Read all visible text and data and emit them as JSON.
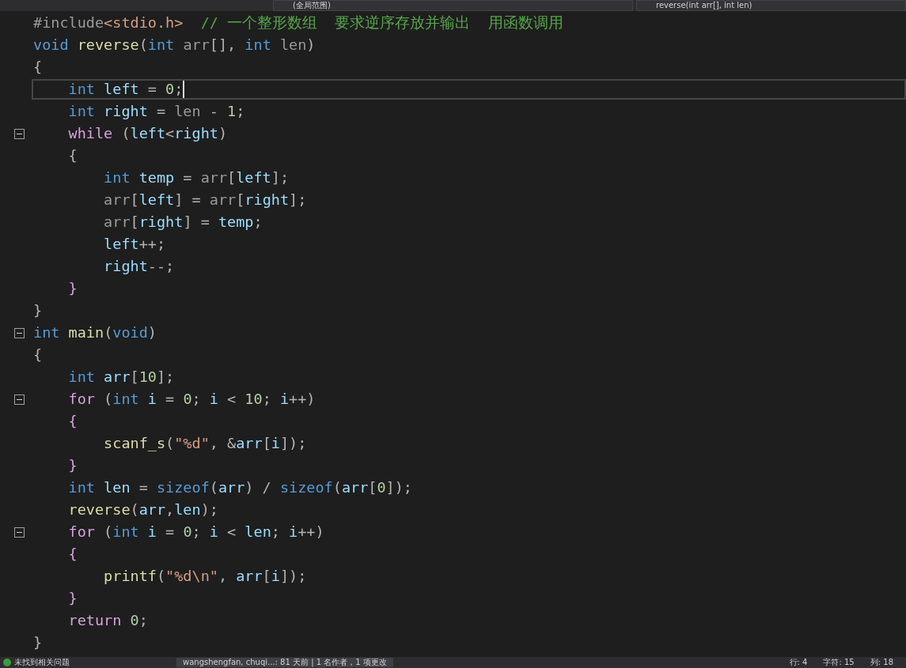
{
  "navigation_bar": {
    "scope": "(全局范围)",
    "member": "reverse(int arr[], int len)"
  },
  "lines": [
    {
      "fold": false,
      "current": false,
      "tokens": [
        {
          "text": "#include",
          "kind": "pp"
        },
        {
          "text": "<stdio.h>",
          "kind": "str"
        },
        {
          "text": "  // 一个整形数组  要求逆序存放并输出  用函数调用",
          "kind": "cmt"
        }
      ]
    },
    {
      "fold": false,
      "current": false,
      "tokens": [
        {
          "text": "void ",
          "kind": "kw"
        },
        {
          "text": "reverse",
          "kind": "fn"
        },
        {
          "text": "(",
          "kind": "p"
        },
        {
          "text": "int ",
          "kind": "kw"
        },
        {
          "text": "arr",
          "kind": "param"
        },
        {
          "text": "[], ",
          "kind": "p"
        },
        {
          "text": "int ",
          "kind": "kw"
        },
        {
          "text": "len",
          "kind": "param"
        },
        {
          "text": ")",
          "kind": "p"
        }
      ]
    },
    {
      "fold": false,
      "current": false,
      "tokens": [
        {
          "text": "{",
          "kind": "p"
        }
      ]
    },
    {
      "fold": false,
      "current": true,
      "tokens": [
        {
          "text": "    int ",
          "kind": "kw"
        },
        {
          "text": "left",
          "kind": "var"
        },
        {
          "text": " = ",
          "kind": "p"
        },
        {
          "text": "0",
          "kind": "num"
        },
        {
          "text": ";",
          "kind": "p"
        }
      ]
    },
    {
      "fold": false,
      "current": false,
      "tokens": [
        {
          "text": "    int ",
          "kind": "kw"
        },
        {
          "text": "right",
          "kind": "var"
        },
        {
          "text": " = ",
          "kind": "p"
        },
        {
          "text": "len",
          "kind": "param"
        },
        {
          "text": " - ",
          "kind": "p"
        },
        {
          "text": "1",
          "kind": "num"
        },
        {
          "text": ";",
          "kind": "p"
        }
      ]
    },
    {
      "fold": true,
      "current": false,
      "tokens": [
        {
          "text": "    while",
          "kind": "ctrl"
        },
        {
          "text": " (",
          "kind": "p"
        },
        {
          "text": "left",
          "kind": "var"
        },
        {
          "text": "<",
          "kind": "p"
        },
        {
          "text": "right",
          "kind": "var"
        },
        {
          "text": ")",
          "kind": "p"
        }
      ]
    },
    {
      "fold": false,
      "current": false,
      "tokens": [
        {
          "text": "    {",
          "kind": "p"
        }
      ]
    },
    {
      "fold": false,
      "current": false,
      "tokens": [
        {
          "text": "        int ",
          "kind": "kw"
        },
        {
          "text": "temp",
          "kind": "var"
        },
        {
          "text": " = ",
          "kind": "p"
        },
        {
          "text": "arr",
          "kind": "param"
        },
        {
          "text": "[",
          "kind": "p"
        },
        {
          "text": "left",
          "kind": "var"
        },
        {
          "text": "];",
          "kind": "p"
        }
      ]
    },
    {
      "fold": false,
      "current": false,
      "tokens": [
        {
          "text": "        arr",
          "kind": "param"
        },
        {
          "text": "[",
          "kind": "p"
        },
        {
          "text": "left",
          "kind": "var"
        },
        {
          "text": "] = ",
          "kind": "p"
        },
        {
          "text": "arr",
          "kind": "param"
        },
        {
          "text": "[",
          "kind": "p"
        },
        {
          "text": "right",
          "kind": "var"
        },
        {
          "text": "];",
          "kind": "p"
        }
      ]
    },
    {
      "fold": false,
      "current": false,
      "tokens": [
        {
          "text": "        arr",
          "kind": "param"
        },
        {
          "text": "[",
          "kind": "p"
        },
        {
          "text": "right",
          "kind": "var"
        },
        {
          "text": "] = ",
          "kind": "p"
        },
        {
          "text": "temp",
          "kind": "var"
        },
        {
          "text": ";",
          "kind": "p"
        }
      ]
    },
    {
      "fold": false,
      "current": false,
      "tokens": [
        {
          "text": "        left",
          "kind": "var"
        },
        {
          "text": "++;",
          "kind": "p"
        }
      ]
    },
    {
      "fold": false,
      "current": false,
      "tokens": [
        {
          "text": "        right",
          "kind": "var"
        },
        {
          "text": "--;",
          "kind": "p"
        }
      ]
    },
    {
      "fold": false,
      "current": false,
      "tokens": [
        {
          "text": "    }",
          "kind": "ctrl"
        }
      ]
    },
    {
      "fold": false,
      "current": false,
      "tokens": [
        {
          "text": "}",
          "kind": "p"
        }
      ]
    },
    {
      "fold": true,
      "current": false,
      "tokens": [
        {
          "text": "int ",
          "kind": "kw"
        },
        {
          "text": "main",
          "kind": "fn"
        },
        {
          "text": "(",
          "kind": "p"
        },
        {
          "text": "void",
          "kind": "kw"
        },
        {
          "text": ")",
          "kind": "p"
        }
      ]
    },
    {
      "fold": false,
      "current": false,
      "tokens": [
        {
          "text": "{",
          "kind": "p"
        }
      ]
    },
    {
      "fold": false,
      "current": false,
      "tokens": [
        {
          "text": "    int ",
          "kind": "kw"
        },
        {
          "text": "arr",
          "kind": "var"
        },
        {
          "text": "[",
          "kind": "p"
        },
        {
          "text": "10",
          "kind": "num"
        },
        {
          "text": "];",
          "kind": "p"
        }
      ]
    },
    {
      "fold": true,
      "current": false,
      "tokens": [
        {
          "text": "    for",
          "kind": "ctrl"
        },
        {
          "text": " (",
          "kind": "p"
        },
        {
          "text": "int ",
          "kind": "kw"
        },
        {
          "text": "i",
          "kind": "var"
        },
        {
          "text": " = ",
          "kind": "p"
        },
        {
          "text": "0",
          "kind": "num"
        },
        {
          "text": "; ",
          "kind": "p"
        },
        {
          "text": "i",
          "kind": "var"
        },
        {
          "text": " < ",
          "kind": "p"
        },
        {
          "text": "10",
          "kind": "num"
        },
        {
          "text": "; ",
          "kind": "p"
        },
        {
          "text": "i",
          "kind": "var"
        },
        {
          "text": "++)",
          "kind": "p"
        }
      ]
    },
    {
      "fold": false,
      "current": false,
      "tokens": [
        {
          "text": "    {",
          "kind": "ctrl"
        }
      ]
    },
    {
      "fold": false,
      "current": false,
      "tokens": [
        {
          "text": "        scanf_s",
          "kind": "fn"
        },
        {
          "text": "(",
          "kind": "p"
        },
        {
          "text": "\"%d\"",
          "kind": "str"
        },
        {
          "text": ", &",
          "kind": "p"
        },
        {
          "text": "arr",
          "kind": "var"
        },
        {
          "text": "[",
          "kind": "p"
        },
        {
          "text": "i",
          "kind": "var"
        },
        {
          "text": "]);",
          "kind": "p"
        }
      ]
    },
    {
      "fold": false,
      "current": false,
      "tokens": [
        {
          "text": "    }",
          "kind": "ctrl"
        }
      ]
    },
    {
      "fold": false,
      "current": false,
      "tokens": [
        {
          "text": "    int ",
          "kind": "kw"
        },
        {
          "text": "len",
          "kind": "var"
        },
        {
          "text": " = ",
          "kind": "p"
        },
        {
          "text": "sizeof",
          "kind": "kw"
        },
        {
          "text": "(",
          "kind": "p"
        },
        {
          "text": "arr",
          "kind": "var"
        },
        {
          "text": ") / ",
          "kind": "p"
        },
        {
          "text": "sizeof",
          "kind": "kw"
        },
        {
          "text": "(",
          "kind": "p"
        },
        {
          "text": "arr",
          "kind": "var"
        },
        {
          "text": "[",
          "kind": "p"
        },
        {
          "text": "0",
          "kind": "num"
        },
        {
          "text": "]);",
          "kind": "p"
        }
      ]
    },
    {
      "fold": false,
      "current": false,
      "tokens": [
        {
          "text": "    reverse",
          "kind": "fn"
        },
        {
          "text": "(",
          "kind": "p"
        },
        {
          "text": "arr",
          "kind": "var"
        },
        {
          "text": ",",
          "kind": "p"
        },
        {
          "text": "len",
          "kind": "var"
        },
        {
          "text": ");",
          "kind": "p"
        }
      ]
    },
    {
      "fold": true,
      "current": false,
      "tokens": [
        {
          "text": "    for",
          "kind": "ctrl"
        },
        {
          "text": " (",
          "kind": "p"
        },
        {
          "text": "int ",
          "kind": "kw"
        },
        {
          "text": "i",
          "kind": "var"
        },
        {
          "text": " = ",
          "kind": "p"
        },
        {
          "text": "0",
          "kind": "num"
        },
        {
          "text": "; ",
          "kind": "p"
        },
        {
          "text": "i",
          "kind": "var"
        },
        {
          "text": " < ",
          "kind": "p"
        },
        {
          "text": "len",
          "kind": "var"
        },
        {
          "text": "; ",
          "kind": "p"
        },
        {
          "text": "i",
          "kind": "var"
        },
        {
          "text": "++)",
          "kind": "p"
        }
      ]
    },
    {
      "fold": false,
      "current": false,
      "tokens": [
        {
          "text": "    {",
          "kind": "ctrl"
        }
      ]
    },
    {
      "fold": false,
      "current": false,
      "tokens": [
        {
          "text": "        printf",
          "kind": "fn"
        },
        {
          "text": "(",
          "kind": "p"
        },
        {
          "text": "\"%d\\n\"",
          "kind": "str"
        },
        {
          "text": ", ",
          "kind": "p"
        },
        {
          "text": "arr",
          "kind": "var"
        },
        {
          "text": "[",
          "kind": "p"
        },
        {
          "text": "i",
          "kind": "var"
        },
        {
          "text": "]);",
          "kind": "p"
        }
      ]
    },
    {
      "fold": false,
      "current": false,
      "tokens": [
        {
          "text": "    }",
          "kind": "ctrl"
        }
      ]
    },
    {
      "fold": false,
      "current": false,
      "tokens": [
        {
          "text": "    return ",
          "kind": "ctrl"
        },
        {
          "text": "0",
          "kind": "num"
        },
        {
          "text": ";",
          "kind": "p"
        }
      ]
    },
    {
      "fold": false,
      "current": false,
      "tokens": [
        {
          "text": "}",
          "kind": "p"
        }
      ]
    }
  ],
  "status_bar": {
    "issues": "未找到相关问题",
    "git_info": "wangshengfan, chuqi...: 81 天前 | 1 名作者，1 项更改",
    "line": "行: 4",
    "char": "字符: 15",
    "col": "列: 18"
  }
}
